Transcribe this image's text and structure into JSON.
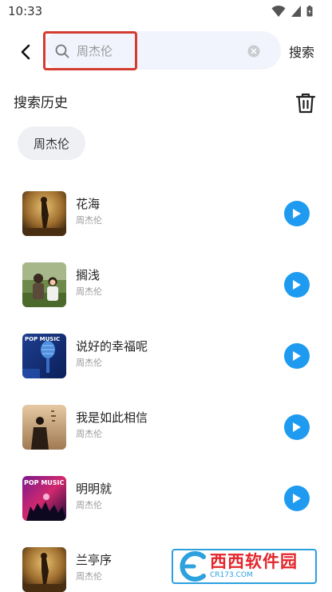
{
  "status_bar": {
    "time": "10:33"
  },
  "search": {
    "placeholder": "周杰伦",
    "value": "",
    "button_label": "搜索"
  },
  "history": {
    "title": "搜索历史",
    "chips": [
      "周杰伦"
    ]
  },
  "songs": [
    {
      "title": "花海",
      "artist": "周杰伦"
    },
    {
      "title": "搁浅",
      "artist": "周杰伦"
    },
    {
      "title": "说好的幸福呢",
      "artist": "周杰伦"
    },
    {
      "title": "我是如此相信",
      "artist": "周杰伦"
    },
    {
      "title": "明明就",
      "artist": "周杰伦"
    },
    {
      "title": "兰亭序",
      "artist": "周杰伦"
    }
  ],
  "covers": {
    "cover2_overlay": "POP MUSIC",
    "cover4_overlay": "POP MUSIC"
  },
  "watermark": {
    "text": "西西软件园",
    "sub": "CR173.COM"
  },
  "colors": {
    "accent_blue": "#1e9bf0",
    "highlight_red": "#d43c32",
    "search_bg": "#f1f4fc"
  }
}
